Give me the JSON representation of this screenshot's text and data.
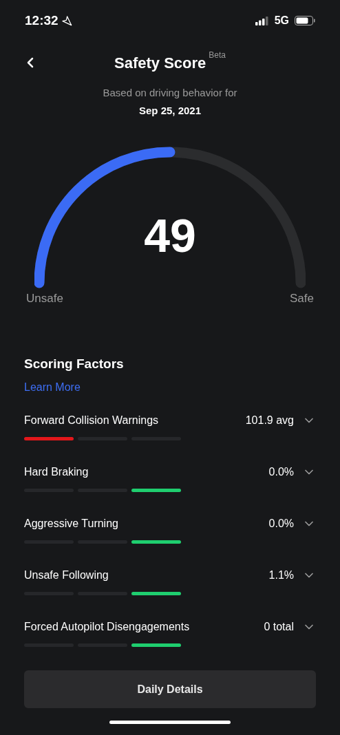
{
  "status_bar": {
    "time": "12:32",
    "network": "5G"
  },
  "header": {
    "title": "Safety Score",
    "badge": "Beta"
  },
  "subtitle": "Based on driving behavior for",
  "date": "Sep 25, 2021",
  "gauge": {
    "score": "49",
    "min_label": "Unsafe",
    "max_label": "Safe"
  },
  "factors_title": "Scoring Factors",
  "learn_more": "Learn More",
  "factors": [
    {
      "name": "Forward Collision Warnings",
      "value": "101.9 avg",
      "color": "#e3171b",
      "segments": [
        {
          "on": true
        },
        {
          "on": false
        },
        {
          "on": false
        }
      ]
    },
    {
      "name": "Hard Braking",
      "value": "0.0%",
      "color": "#1fce6f",
      "segments": [
        {
          "on": false
        },
        {
          "on": false
        },
        {
          "on": true
        }
      ]
    },
    {
      "name": "Aggressive Turning",
      "value": "0.0%",
      "color": "#1fce6f",
      "segments": [
        {
          "on": false
        },
        {
          "on": false
        },
        {
          "on": true
        }
      ]
    },
    {
      "name": "Unsafe Following",
      "value": "1.1%",
      "color": "#1fce6f",
      "segments": [
        {
          "on": false
        },
        {
          "on": false
        },
        {
          "on": true
        }
      ]
    },
    {
      "name": "Forced Autopilot Disengagements",
      "value": "0 total",
      "color": "#1fce6f",
      "segments": [
        {
          "on": false
        },
        {
          "on": false
        },
        {
          "on": true
        }
      ]
    }
  ],
  "button": "Daily Details"
}
